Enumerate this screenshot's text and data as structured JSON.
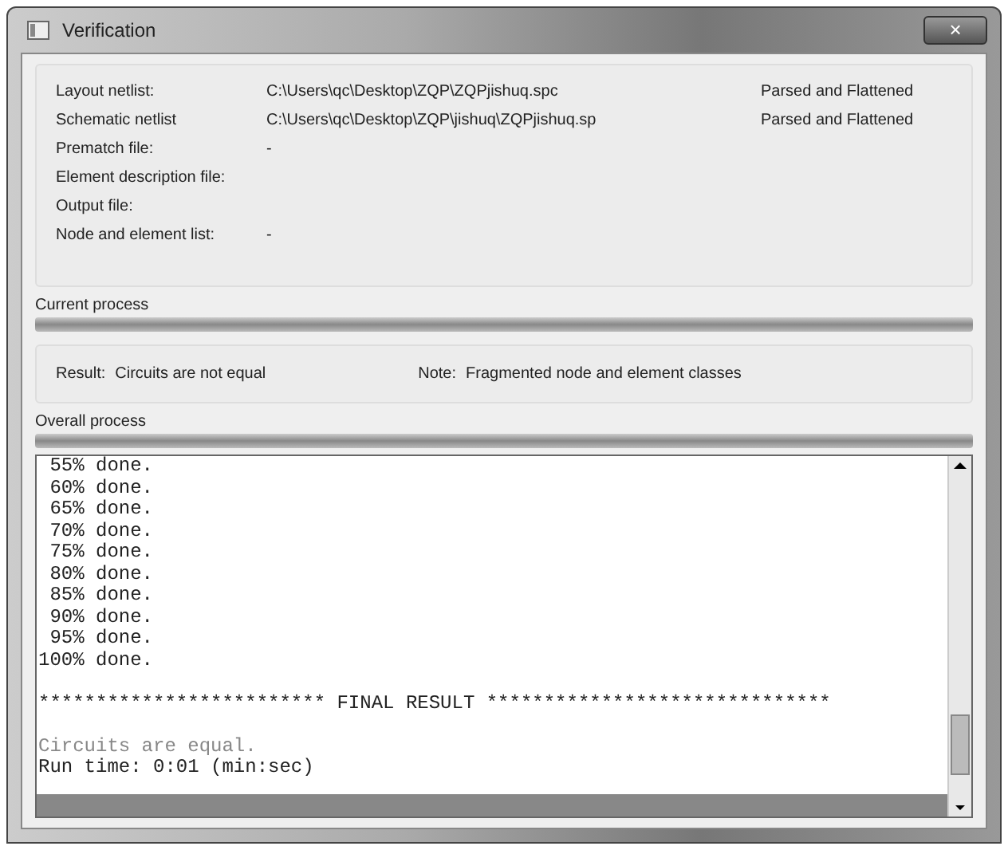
{
  "window": {
    "title": "Verification",
    "close_label": "×"
  },
  "files": [
    {
      "label": "Layout netlist:",
      "value": "C:\\Users\\qc\\Desktop\\ZQP\\ZQPjishuq.spc",
      "status": "Parsed and Flattened"
    },
    {
      "label": "Schematic netlist",
      "value": "C:\\Users\\qc\\Desktop\\ZQP\\jishuq\\ZQPjishuq.sp",
      "status": "Parsed and Flattened"
    },
    {
      "label": "Prematch file:",
      "value": "-"
    },
    {
      "label": "Element description file:"
    },
    {
      "label": "Output file:"
    },
    {
      "label": "Node and element list:",
      "value": "-"
    }
  ],
  "current_process": {
    "label": "Current process",
    "level": 1
  },
  "result": {
    "label": "Result:",
    "value": "Circuits are not equal",
    "note_label": "Note:",
    "note": "Fragmented node and element classes"
  },
  "overall_process": {
    "label": "Overall process",
    "level": 1
  },
  "console": {
    "lines": [
      {
        "text": " 55% done.",
        "kind": "normal"
      },
      {
        "text": " 60% done.",
        "kind": "normal"
      },
      {
        "text": " 65% done.",
        "kind": "normal"
      },
      {
        "text": " 70% done.",
        "kind": "normal"
      },
      {
        "text": " 75% done.",
        "kind": "normal"
      },
      {
        "text": " 80% done.",
        "kind": "normal"
      },
      {
        "text": " 85% done.",
        "kind": "normal"
      },
      {
        "text": " 90% done.",
        "kind": "normal"
      },
      {
        "text": " 95% done.",
        "kind": "normal"
      },
      {
        "text": "100% done.",
        "kind": "normal"
      },
      {
        "kind": "blank"
      },
      {
        "text": "************************* FINAL RESULT ******************************",
        "kind": "normal"
      },
      {
        "kind": "blank"
      },
      {
        "text": "Circuits are equal.",
        "kind": "muted"
      },
      {
        "text": "Run time: 0:01 (min:sec)",
        "kind": "normal"
      }
    ]
  }
}
